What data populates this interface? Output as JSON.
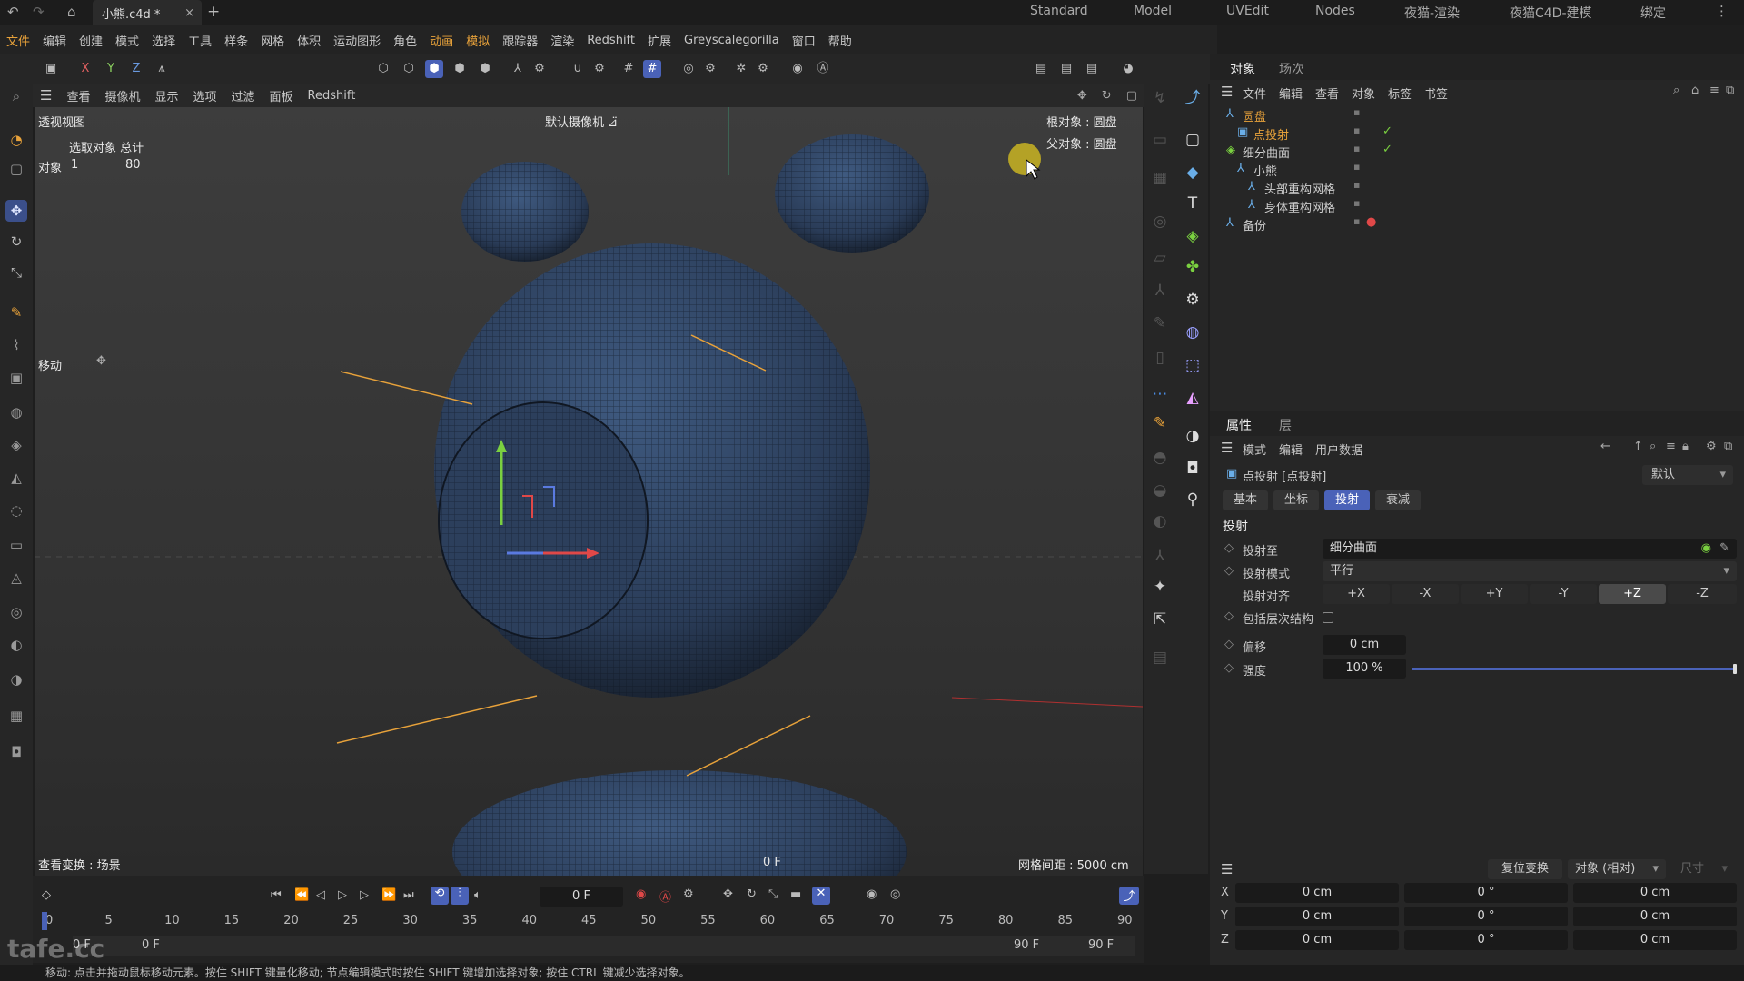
{
  "title": {
    "tab": "小熊.c4d *",
    "close": "×",
    "add": "+"
  },
  "layouts": [
    "Standard",
    "Model",
    "UVEdit",
    "Nodes",
    "夜猫-渲染",
    "夜猫C4D-建模",
    "绑定"
  ],
  "menu": [
    "文件",
    "编辑",
    "创建",
    "模式",
    "选择",
    "工具",
    "样条",
    "网格",
    "体积",
    "运动图形",
    "角色",
    "动画",
    "模拟",
    "跟踪器",
    "渲染",
    "Redshift",
    "扩展",
    "Greyscalegorilla",
    "窗口",
    "帮助"
  ],
  "axes": {
    "x": "X",
    "y": "Y",
    "z": "Z"
  },
  "vpmenu": [
    "查看",
    "摄像机",
    "显示",
    "选项",
    "过滤",
    "面板",
    "Redshift"
  ],
  "viewport": {
    "name": "透视视图",
    "camera": "默认摄像机 ⊿̈",
    "sel_header": "选取对象 总计",
    "sel_label": "对象",
    "sel_count": "1",
    "sel_total": "80",
    "root": "根对象 : 圆盘",
    "parent": "父对象 : 圆盘",
    "move": "移动",
    "view_transform": "查看变换 : 场景",
    "frame": "0 F",
    "grid": "网格间距 : 5000 cm"
  },
  "objpanel": {
    "tabs": [
      "对象",
      "场次"
    ],
    "menu": [
      "文件",
      "编辑",
      "查看",
      "对象",
      "标签",
      "书签"
    ],
    "tree": [
      {
        "name": "圆盘",
        "indent": 0,
        "color": "#e8a23a"
      },
      {
        "name": "点投射",
        "indent": 1,
        "color": "#e8a23a"
      },
      {
        "name": "细分曲面",
        "indent": 0,
        "color": "#cfcfcf"
      },
      {
        "name": "小熊",
        "indent": 1,
        "color": "#cfcfcf"
      },
      {
        "name": "头部重构网格",
        "indent": 2,
        "color": "#cfcfcf"
      },
      {
        "name": "身体重构网格",
        "indent": 2,
        "color": "#cfcfcf"
      },
      {
        "name": "备份",
        "indent": 0,
        "color": "#cfcfcf"
      }
    ]
  },
  "attrpanel": {
    "tabs": [
      "属性",
      "层"
    ],
    "menu": [
      "模式",
      "编辑",
      "用户数据"
    ],
    "object": "点投射 [点投射]",
    "preset": "默认",
    "subtabs": [
      "基本",
      "坐标",
      "投射",
      "衰减"
    ],
    "section": "投射",
    "project_to_label": "投射至",
    "project_to": "细分曲面",
    "mode_label": "投射模式",
    "mode": "平行",
    "align_label": "投射对齐",
    "align": [
      "+X",
      "-X",
      "+Y",
      "-Y",
      "+Z",
      "-Z"
    ],
    "hier_label": "包括层次结构",
    "offset_label": "偏移",
    "offset": "0 cm",
    "strength_label": "强度",
    "strength": "100 %",
    "strength_value": 1.0
  },
  "coord": {
    "reset": "复位变换",
    "mode": "对象 (相对)",
    "size": "尺寸",
    "rows": [
      {
        "axis": "X",
        "pos": "0 cm",
        "rot": "0 °",
        "scale": "0 cm"
      },
      {
        "axis": "Y",
        "pos": "0 cm",
        "rot": "0 °",
        "scale": "0 cm"
      },
      {
        "axis": "Z",
        "pos": "0 cm",
        "rot": "0 °",
        "scale": "0 cm"
      }
    ]
  },
  "timeline": {
    "frame": "0 F",
    "ticks": [
      "0",
      "5",
      "10",
      "15",
      "20",
      "25",
      "30",
      "35",
      "40",
      "45",
      "50",
      "55",
      "60",
      "65",
      "70",
      "75",
      "80",
      "85",
      "90"
    ],
    "start": "0 F",
    "start2": "0 F",
    "end": "90 F",
    "end2": "90 F"
  },
  "status": "移动: 点击并拖动鼠标移动元素。按住 SHIFT 键量化移动; 节点编辑模式时按住 SHIFT 键增加选择对象; 按住 CTRL 键减少选择对象。",
  "watermark": "tafe.cc"
}
